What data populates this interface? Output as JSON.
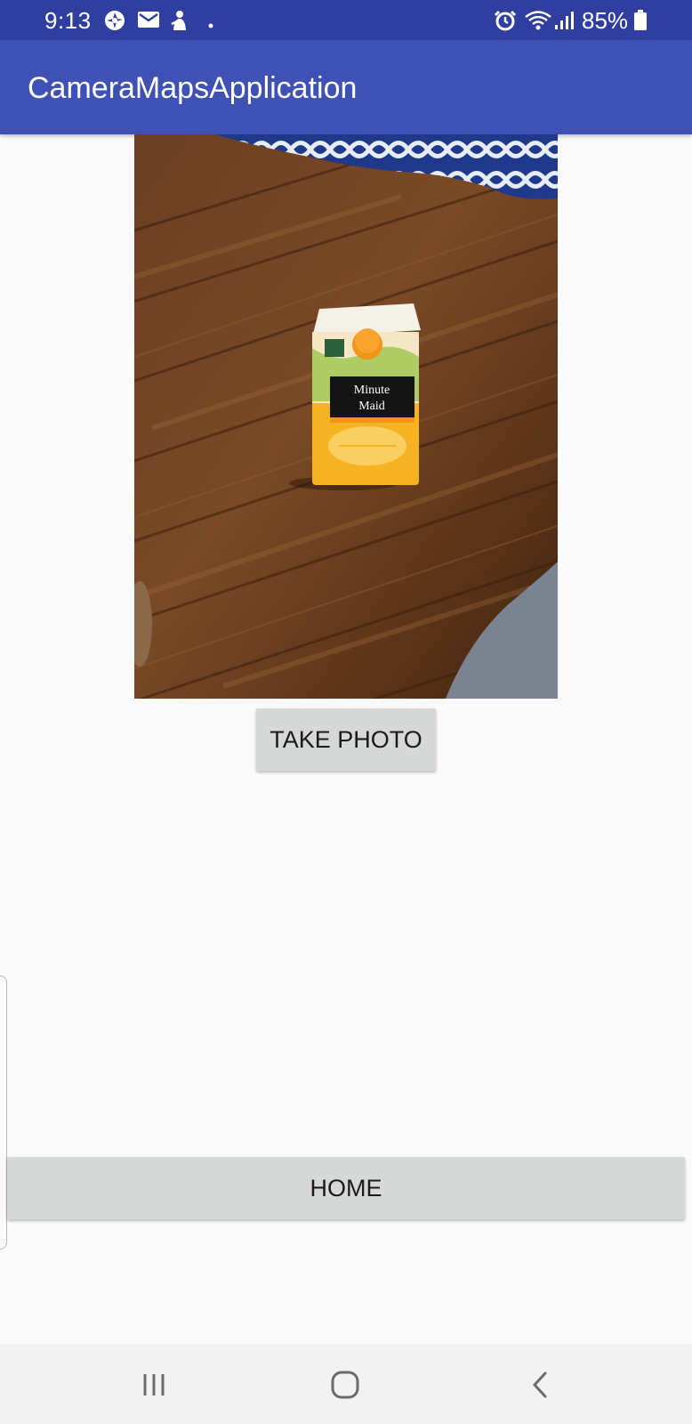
{
  "status_bar": {
    "time": "9:13",
    "battery_percent": "85%",
    "color": "#303f9f",
    "left_icons": [
      "camera-aperture-icon",
      "gmail-icon",
      "person-icon",
      "notification-dot-icon"
    ],
    "right_icons": [
      "alarm-icon",
      "wifi-icon",
      "signal-icon",
      "battery-icon"
    ]
  },
  "app_bar": {
    "title": "CameraMapsApplication",
    "color": "#3f51b5"
  },
  "photo": {
    "description_icon": "captured-photo",
    "subject": "orange-juice-carton",
    "carton_brand": "Minute Maid"
  },
  "buttons": {
    "take_photo": "TAKE PHOTO",
    "home": "HOME"
  },
  "nav_bar": {
    "icons": [
      "recent-apps-icon",
      "home-icon",
      "back-icon"
    ]
  }
}
